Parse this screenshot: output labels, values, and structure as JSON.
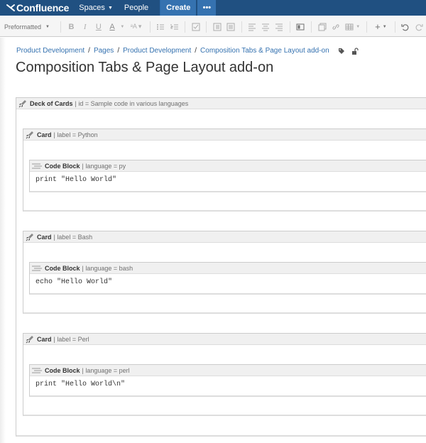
{
  "topnav": {
    "logo_text": "Confluence",
    "spaces_label": "Spaces",
    "people_label": "People",
    "create_label": "Create",
    "more_label": "•••"
  },
  "toolbar": {
    "format_label": "Preformatted",
    "icons": [
      "bold-icon",
      "italic-icon",
      "underline-icon",
      "text-color-icon",
      "text-style-icon",
      "bullet-list-icon",
      "numbered-list-icon",
      "task-list-icon",
      "outdent-icon",
      "indent-icon",
      "align-left-icon",
      "align-center-icon",
      "align-right-icon",
      "page-layout-icon",
      "template-icon",
      "link-icon",
      "table-icon",
      "insert-icon",
      "undo-icon",
      "redo-icon"
    ]
  },
  "breadcrumbs": [
    "Product Development",
    "Pages",
    "Product Development",
    "Composition Tabs & Page Layout add-on"
  ],
  "page": {
    "title": "Composition Tabs & Page Layout add-on"
  },
  "deck": {
    "name": "Deck of Cards",
    "params": "| id = Sample code in various languages"
  },
  "cards": [
    {
      "name": "Card",
      "params": "| label = Python",
      "code_name": "Code Block",
      "code_params": "| language = py",
      "code": "print \"Hello World\""
    },
    {
      "name": "Card",
      "params": "| label = Bash",
      "code_name": "Code Block",
      "code_params": "| language = bash",
      "code": "echo \"Hello World\""
    },
    {
      "name": "Card",
      "params": "| label = Perl",
      "code_name": "Code Block",
      "code_params": "| language = perl",
      "code": "print \"Hello World\\n\""
    }
  ],
  "colors": {
    "nav": "#205081",
    "create": "#3572b0",
    "link": "#3572b0"
  }
}
